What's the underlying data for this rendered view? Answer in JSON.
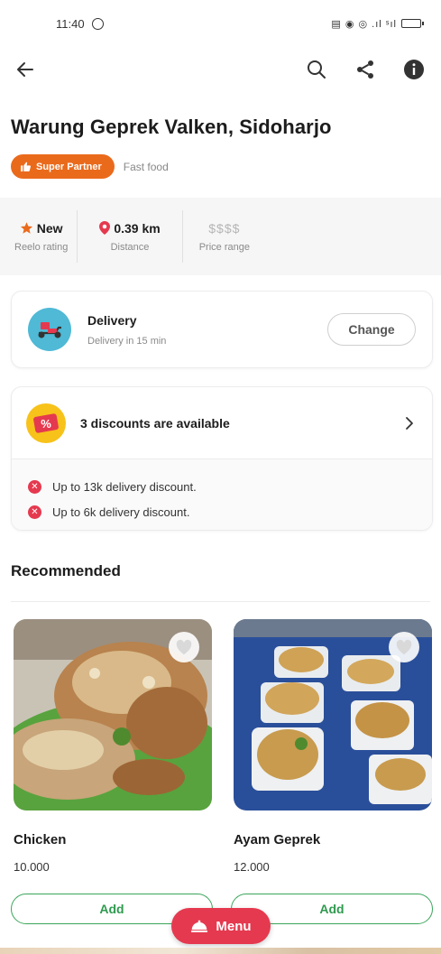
{
  "status_bar": {
    "time": "11:40",
    "indicators": "▤ ◉ ◎ .ıl ˢıl"
  },
  "restaurant": {
    "name": "Warung Geprek Valken, Sidoharjo",
    "badge": "Super Partner",
    "cuisine": "Fast food"
  },
  "info": [
    {
      "value": "New",
      "label": "Reelo rating",
      "icon": "star-icon"
    },
    {
      "value": "0.39 km",
      "label": "Distance",
      "icon": "location-pin-icon"
    },
    {
      "value": "$$$$",
      "label": "Price range"
    }
  ],
  "delivery": {
    "title": "Delivery",
    "subtitle": "Delivery in 15 min",
    "change_label": "Change"
  },
  "discounts": {
    "title": "3 discounts are available",
    "items": [
      "Up to 13k delivery discount.",
      "Up to 6k delivery discount."
    ]
  },
  "recommended": {
    "title": "Recommended",
    "products": [
      {
        "name": "Chicken",
        "price": "10.000",
        "add_label": "Add"
      },
      {
        "name": "Ayam Geprek",
        "price": "12.000",
        "add_label": "Add"
      }
    ]
  },
  "menu_button": {
    "label": "Menu"
  },
  "colors": {
    "brand_red": "#e5394f",
    "partner_orange": "#ea6a1c",
    "add_green": "#2f9a4f",
    "delivery_blue": "#4fb9d6",
    "discount_yellow": "#f7c21a"
  }
}
